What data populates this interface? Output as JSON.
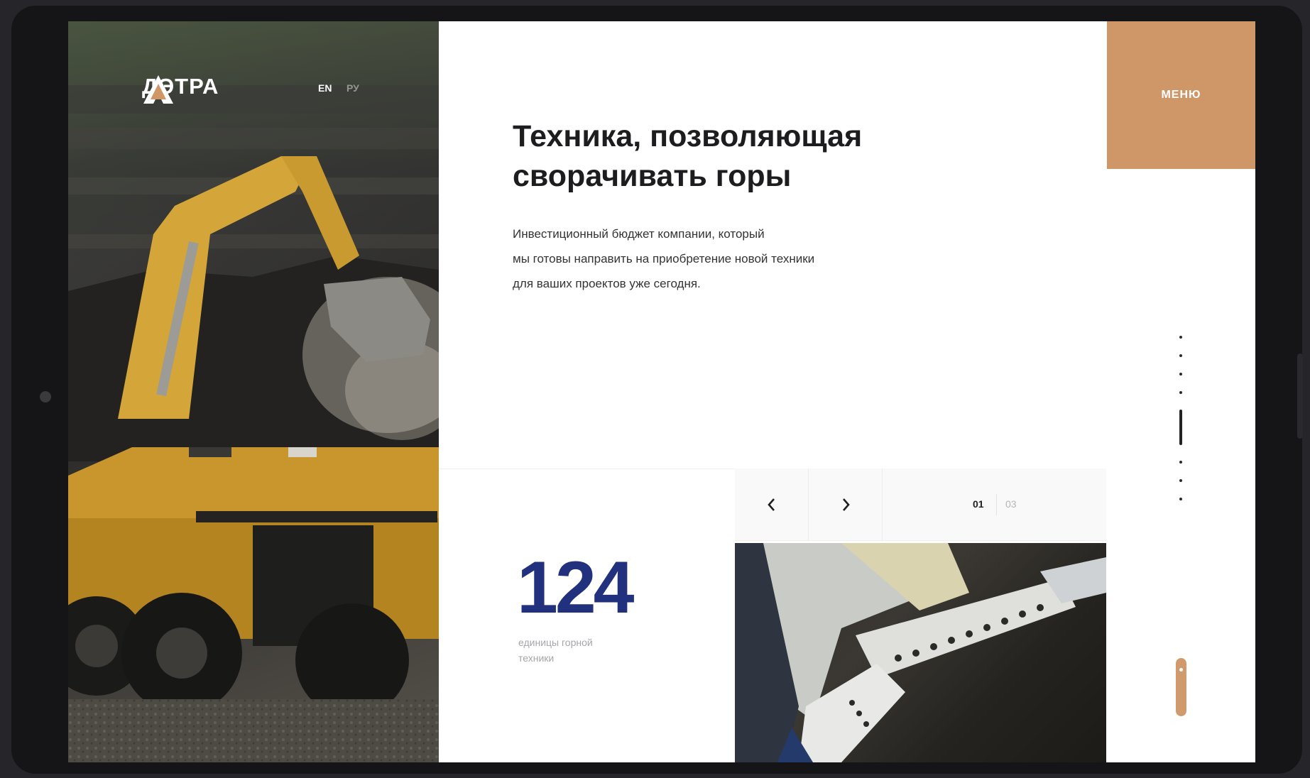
{
  "brand": {
    "name": "ДЭТРА"
  },
  "languages": [
    {
      "code": "EN",
      "active": true
    },
    {
      "code": "РУ",
      "active": false
    }
  ],
  "menu": {
    "label": "МЕНЮ"
  },
  "hero": {
    "headline_line1": "Техника, позволяющая",
    "headline_line2": "сворачивать горы",
    "desc_line1": "Инвестиционный бюджет компании, который",
    "desc_line2": "мы готовы направить на приобретение новой техники",
    "desc_line3": "для ваших проектов уже сегодня."
  },
  "stat": {
    "value": "124",
    "label_line1": "единицы горной",
    "label_line2": "техники"
  },
  "slider": {
    "prev_icon": "chevron-left-icon",
    "next_icon": "chevron-right-icon",
    "current": "01",
    "total": "03"
  },
  "section_nav": {
    "count": 8,
    "active_index": 4
  },
  "colors": {
    "accent": "#cf9668",
    "stat_blue": "#22317e",
    "text_dark": "#1d1d1f"
  }
}
